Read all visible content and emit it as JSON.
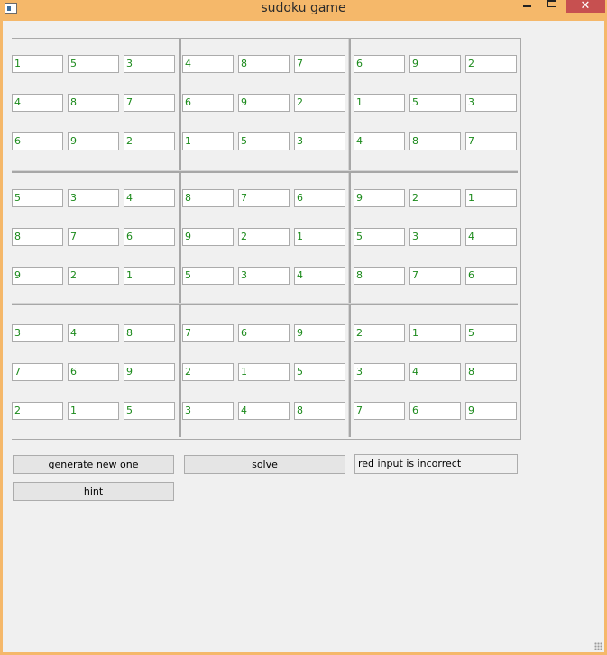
{
  "window": {
    "title": "sudoku game"
  },
  "controls": {
    "minimize": "minimize",
    "maximize": "maximize",
    "close": "✕"
  },
  "grid": {
    "cells": [
      [
        "1",
        "5",
        "3",
        "4",
        "8",
        "7",
        "6",
        "9",
        "2"
      ],
      [
        "4",
        "8",
        "7",
        "6",
        "9",
        "2",
        "1",
        "5",
        "3"
      ],
      [
        "6",
        "9",
        "2",
        "1",
        "5",
        "3",
        "4",
        "8",
        "7"
      ],
      [
        "5",
        "3",
        "4",
        "8",
        "7",
        "6",
        "9",
        "2",
        "1"
      ],
      [
        "8",
        "7",
        "6",
        "9",
        "2",
        "1",
        "5",
        "3",
        "4"
      ],
      [
        "9",
        "2",
        "1",
        "5",
        "3",
        "4",
        "8",
        "7",
        "6"
      ],
      [
        "3",
        "4",
        "8",
        "7",
        "6",
        "9",
        "2",
        "1",
        "5"
      ],
      [
        "7",
        "6",
        "9",
        "2",
        "1",
        "5",
        "3",
        "4",
        "8"
      ],
      [
        "2",
        "1",
        "5",
        "3",
        "4",
        "8",
        "7",
        "6",
        "9"
      ]
    ],
    "cell_color": "#1b8a1b"
  },
  "actions": {
    "generate_label": "generate new one",
    "solve_label": "solve",
    "hint_label": "hint"
  },
  "status": {
    "message": "red input is incorrect"
  },
  "colors": {
    "titlebar": "#f5b86a",
    "close_button": "#c75050",
    "background": "#f0f0f0"
  }
}
